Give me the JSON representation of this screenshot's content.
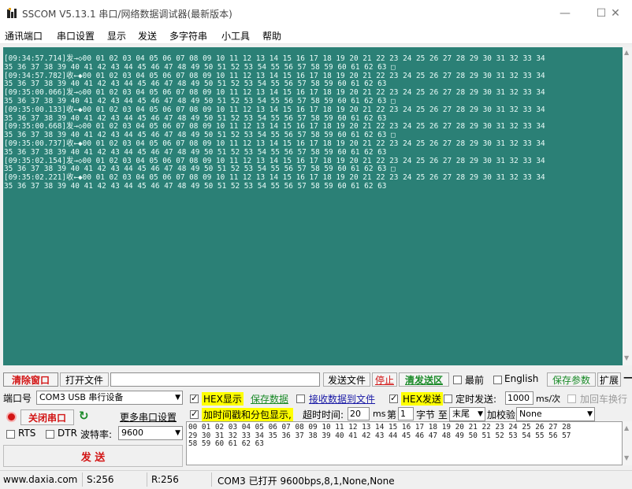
{
  "window": {
    "title": "SSCOM V5.13.1 串口/网络数据调试器(最新版本)",
    "minimize": "—",
    "maximize": "☐",
    "close": "✕"
  },
  "menu": [
    "通讯端口",
    "串口设置",
    "显示",
    "发送",
    "多字符串",
    "小工具",
    "帮助"
  ],
  "terminal": {
    "lines": [
      "[09:34:57.714]发→◇00 01 02 03 04 05 06 07 08 09 10 11 12 13 14 15 16 17 18 19 20 21 22 23 24 25 26 27 28 29 30 31 32 33 34",
      "35 36 37 38 39 40 41 42 43 44 45 46 47 48 49 50 51 52 53 54 55 56 57 58 59 60 61 62 63 □",
      "[09:34:57.782]收←◆00 01 02 03 04 05 06 07 08 09 10 11 12 13 14 15 16 17 18 19 20 21 22 23 24 25 26 27 28 29 30 31 32 33 34",
      "35 36 37 38 39 40 41 42 43 44 45 46 47 48 49 50 51 52 53 54 55 56 57 58 59 60 61 62 63",
      "[09:35:00.066]发→◇00 01 02 03 04 05 06 07 08 09 10 11 12 13 14 15 16 17 18 19 20 21 22 23 24 25 26 27 28 29 30 31 32 33 34",
      "35 36 37 38 39 40 41 42 43 44 45 46 47 48 49 50 51 52 53 54 55 56 57 58 59 60 61 62 63 □",
      "[09:35:00.133]收←◆00 01 02 03 04 05 06 07 08 09 10 11 12 13 14 15 16 17 18 19 20 21 22 23 24 25 26 27 28 29 30 31 32 33 34",
      "35 36 37 38 39 40 41 42 43 44 45 46 47 48 49 50 51 52 53 54 55 56 57 58 59 60 61 62 63",
      "[09:35:00.668]发→◇00 01 02 03 04 05 06 07 08 09 10 11 12 13 14 15 16 17 18 19 20 21 22 23 24 25 26 27 28 29 30 31 32 33 34",
      "35 36 37 38 39 40 41 42 43 44 45 46 47 48 49 50 51 52 53 54 55 56 57 58 59 60 61 62 63 □",
      "[09:35:00.737]收←◆00 01 02 03 04 05 06 07 08 09 10 11 12 13 14 15 16 17 18 19 20 21 22 23 24 25 26 27 28 29 30 31 32 33 34",
      "35 36 37 38 39 40 41 42 43 44 45 46 47 48 49 50 51 52 53 54 55 56 57 58 59 60 61 62 63",
      "[09:35:02.154]发→◇00 01 02 03 04 05 06 07 08 09 10 11 12 13 14 15 16 17 18 19 20 21 22 23 24 25 26 27 28 29 30 31 32 33 34",
      "35 36 37 38 39 40 41 42 43 44 45 46 47 48 49 50 51 52 53 54 55 56 57 58 59 60 61 62 63 □",
      "[09:35:02.221]收←◆00 01 02 03 04 05 06 07 08 09 10 11 12 13 14 15 16 17 18 19 20 21 22 23 24 25 26 27 28 29 30 31 32 33 34",
      "35 36 37 38 39 40 41 42 43 44 45 46 47 48 49 50 51 52 53 54 55 56 57 58 59 60 61 62 63"
    ]
  },
  "toolbar": {
    "clear_window": "清除窗口",
    "open_file": "打开文件",
    "send_file": "发送文件",
    "stop": "停止",
    "clear_send": "清发送区",
    "topmost": "最前",
    "english": "English",
    "save_params": "保存参数",
    "expand": "扩展",
    "expand_tail": "—"
  },
  "port": {
    "label": "端口号",
    "value": "COM3 USB 串行设备",
    "close_port": "关闭串口",
    "more_settings": "更多串口设置",
    "rts": "RTS",
    "dtr": "DTR",
    "baud_label": "波特率:",
    "baud_value": "9600",
    "send": "发 送"
  },
  "options": {
    "hex_display": "HEX显示",
    "save_data": "保存数据",
    "recv_to_file": "接收数据到文件",
    "hex_send": "HEX发送",
    "timed_send": "定时发送:",
    "timed_value": "1000",
    "timed_unit": "ms/次",
    "add_crlf": "加回车换行",
    "timestamp": "加时间戳和分包显示,",
    "timeout_label": "超时时间:",
    "timeout_value": "20",
    "ms": "ms",
    "byte_prefix": "第",
    "byte_value": "1",
    "byte_label": "字节 至",
    "end_value": "末尾",
    "checksum_label": "加校验",
    "checksum_value": "None"
  },
  "send_area": {
    "lines": [
      "00 01 02 03 04 05 06 07 08 09 10 11 12 13 14 15 16 17 18 19 20 21 22 23 24 25 26 27 28",
      "29 30 31 32 33 34 35 36 37 38 39 40 41 42 43 44 45 46 47 48 49 50 51 52 53 54 55 56 57",
      "58 59 60 61 62 63"
    ]
  },
  "status": {
    "website": "www.daxia.com",
    "sent": "S:256",
    "received": "R:256",
    "port_status": "COM3 已打开  9600bps,8,1,None,None"
  },
  "colors": {
    "terminal_bg": "#2b8076",
    "terminal_text": "#e9fbf8",
    "highlight_yellow": "#ffff00",
    "link_green": "#1a8a28",
    "alert_red": "#d21414"
  }
}
